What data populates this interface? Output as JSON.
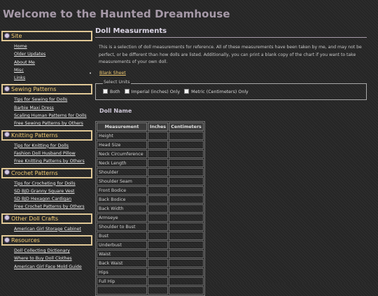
{
  "site_title": "Welcome to the Haunted Dreamhouse",
  "sidebar": {
    "sections": [
      {
        "title": "Site",
        "links": [
          "Home",
          "Older Updates",
          "About Me",
          "Misc",
          "Links"
        ]
      },
      {
        "title": "Sewing Patterns",
        "links": [
          "Tips for Sewing for Dolls",
          "Barbie Maxi Dress",
          "Scaling Human Patterns for Dolls",
          "Free Sewing Patterns by Others"
        ]
      },
      {
        "title": "Knitting Patterns",
        "links": [
          "Tips for Knitting for Dolls",
          "Fashion Doll Husband Pillow",
          "Free Knitting Patterns by Others"
        ]
      },
      {
        "title": "Crochet Patterns",
        "links": [
          "Tips for Crocheting for Dolls",
          "SD BJD Granny Square Vest",
          "SD BJD Hexagon Cardigan",
          "Free Crochet Patterns by Others"
        ]
      },
      {
        "title": "Other Doll Crafts",
        "links": [
          "American Girl Storage Cabinet"
        ]
      },
      {
        "title": "Resources",
        "links": [
          "Doll Collecting Dictionary",
          "Where to Buy Doll Clothes",
          "American Girl Face Mold Guide"
        ]
      }
    ]
  },
  "main": {
    "heading": "Doll Measurments",
    "intro": "This is a selection of doll measurements for reference. All of these measurements have been taken by me, and may not be perfect, or be different than how dolls are listed. Additionally, you can print a blank copy of the chart if you want to take measurements of your own doll.",
    "blank_sheet": "Blank Sheet",
    "units": {
      "legend": "Select Units",
      "options": [
        "Both",
        "Imperial (inches) Only",
        "Metric (Centimeters) Only"
      ]
    },
    "doll_name": "Doll Name",
    "table": {
      "headers": [
        "Measurement",
        "Inches",
        "Centimeters"
      ],
      "rows": [
        "Height",
        "Head Size",
        "Neck Circumference",
        "Neck Length",
        "Shoulder",
        "Shoulder Seam",
        "Front Bodice",
        "Back Bodice",
        "Back Width",
        "Armseye",
        "Shoulder to Bust",
        "Bust",
        "Underbust",
        "Waist",
        "Back Waist",
        "Hips",
        "Full Hip",
        ""
      ]
    }
  },
  "colors": {
    "background": "#262626",
    "title": "#a79aa9",
    "accent": "#f2cb72",
    "header_border": "#e0c896"
  }
}
